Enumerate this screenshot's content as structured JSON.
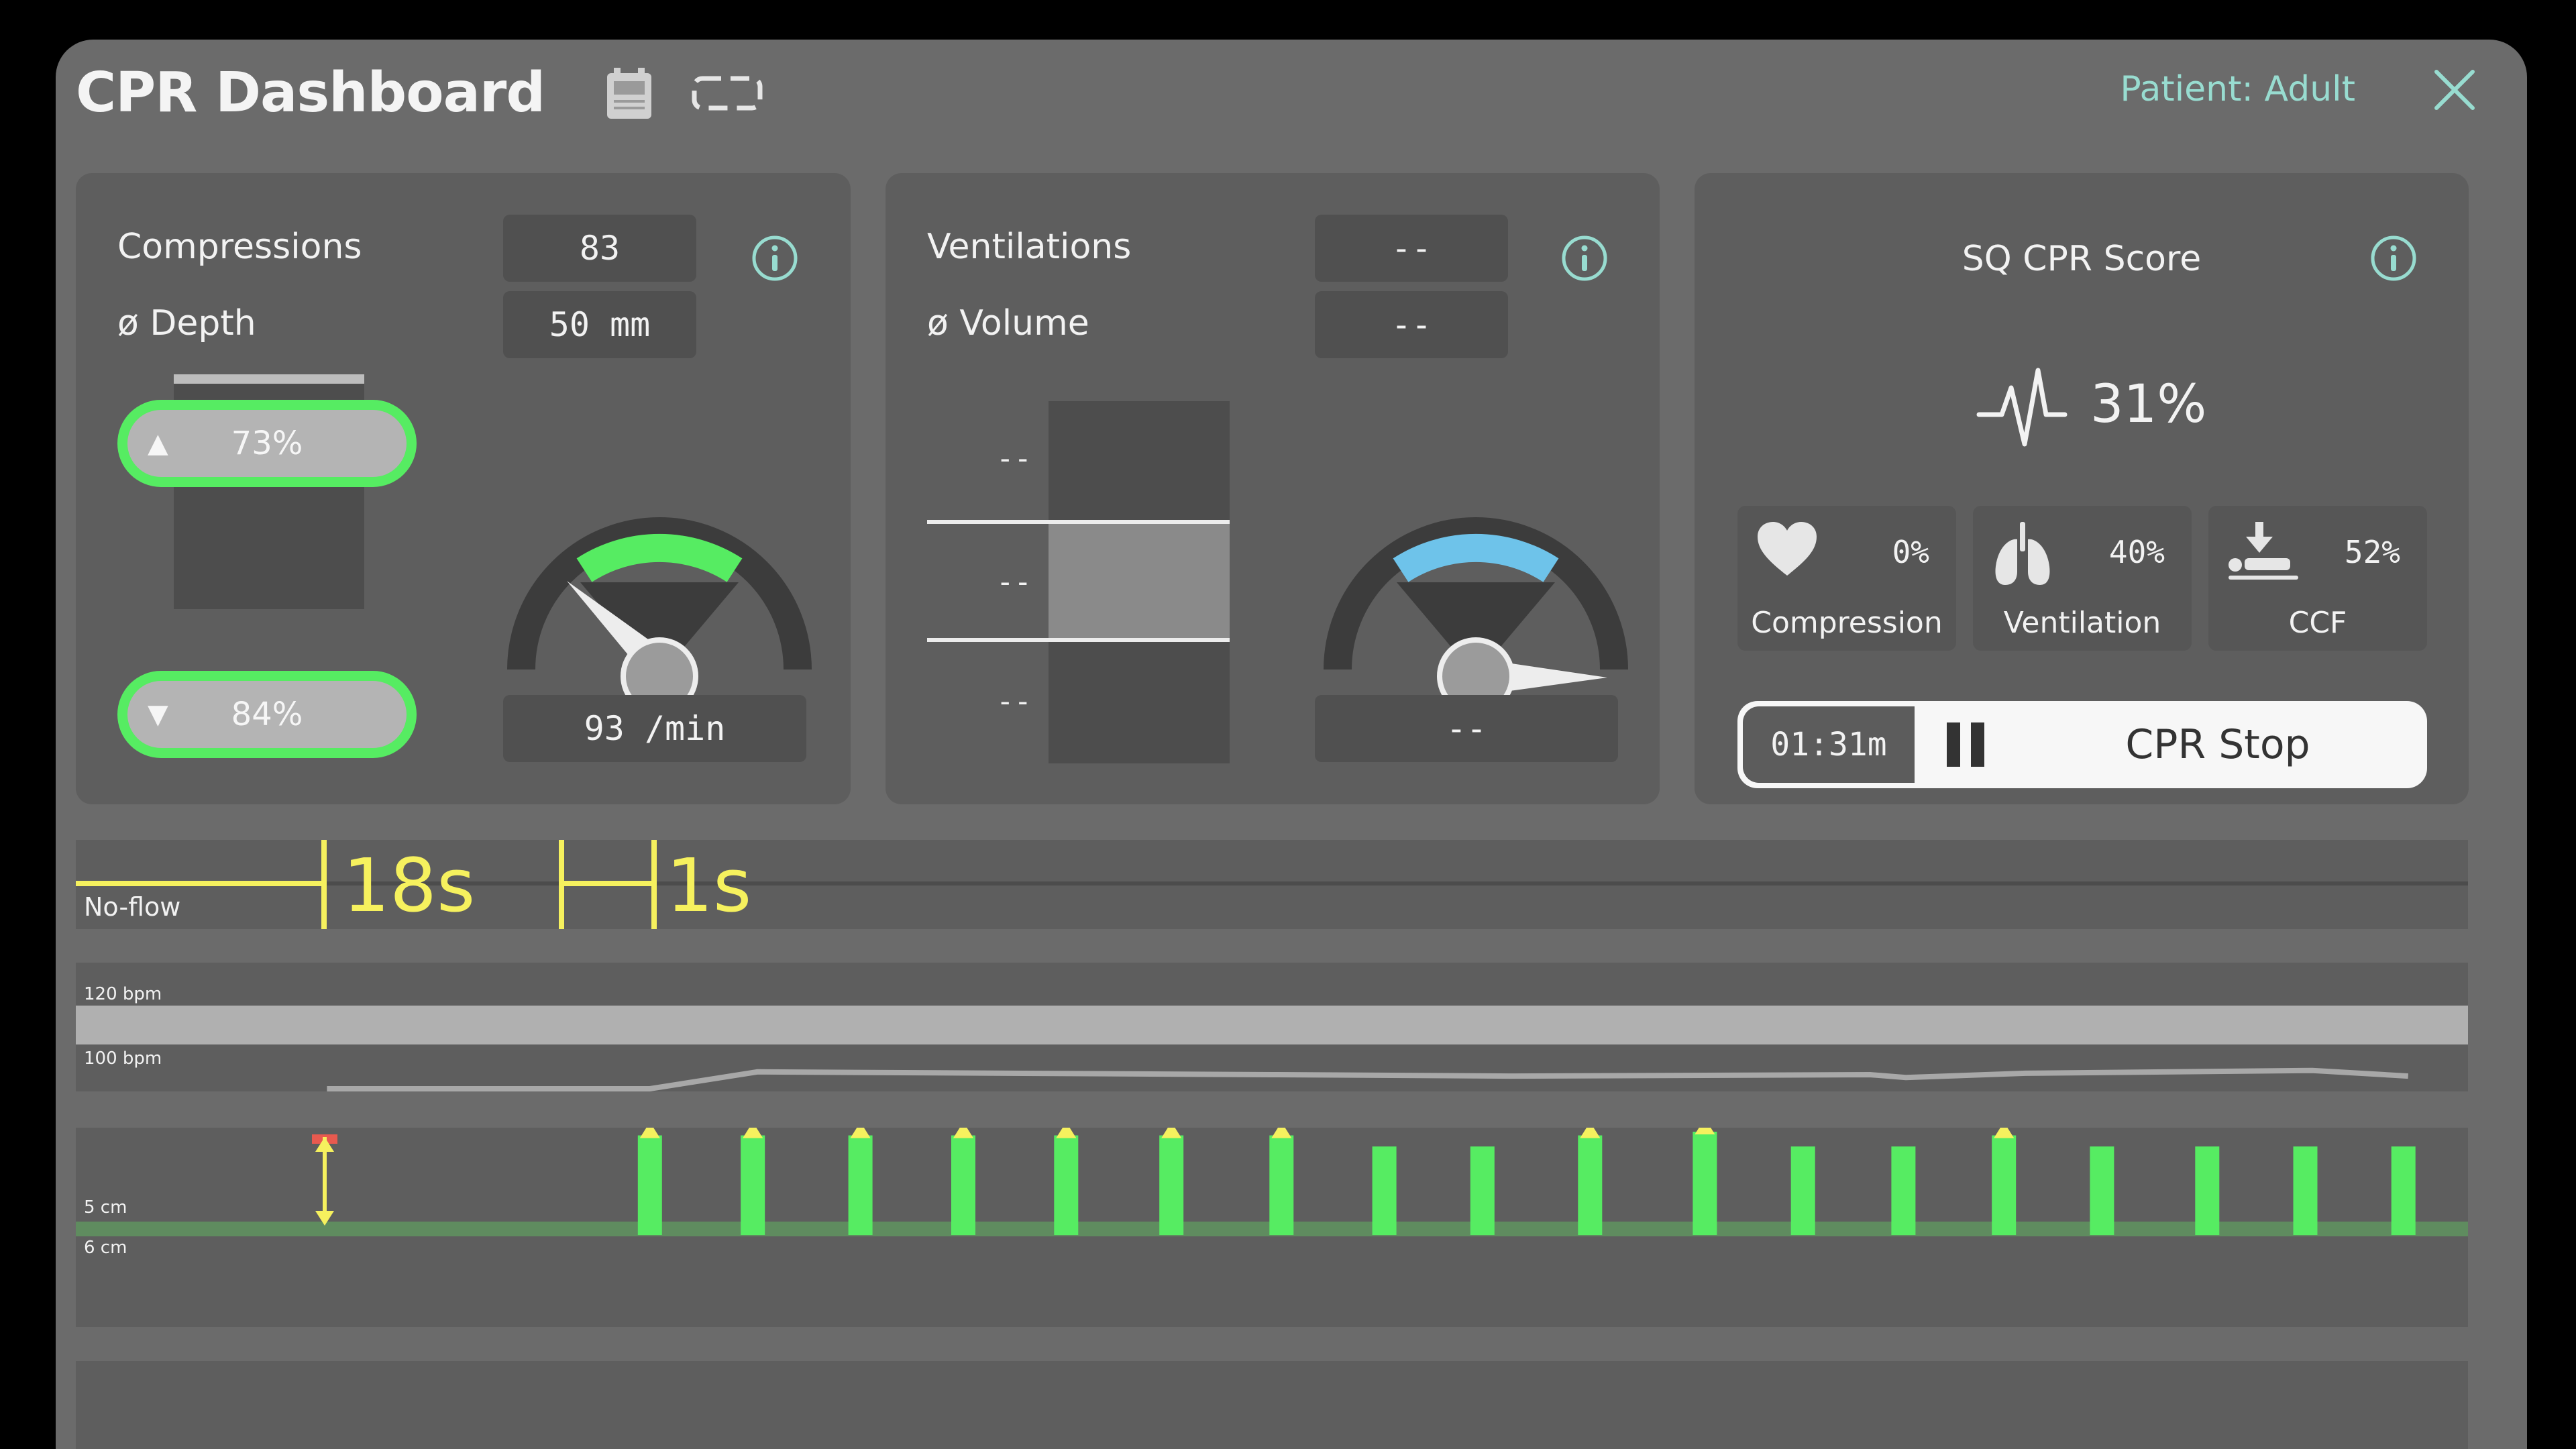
{
  "header": {
    "title": "CPR Dashboard",
    "patient": "Patient: Adult"
  },
  "compressions": {
    "label": "Compressions",
    "value": "83",
    "depth_label": "ø Depth",
    "depth_value": "50 mm",
    "upper_pct": "73%",
    "lower_pct": "84%",
    "rate": "93 /min"
  },
  "ventilations": {
    "label": "Ventilations",
    "value": "--",
    "volume_label": "ø Volume",
    "volume_value": "--",
    "bar_top": "--",
    "bar_mid": "--",
    "bar_bottom": "--",
    "rate": "--"
  },
  "score": {
    "title": "SQ CPR Score",
    "value": "31%",
    "tiles": [
      {
        "name": "Compression",
        "value": "0%"
      },
      {
        "name": "Ventilation",
        "value": "40%"
      },
      {
        "name": "CCF",
        "value": "52%"
      }
    ]
  },
  "timer": {
    "elapsed": "01:31m",
    "stop_label": "CPR Stop"
  },
  "noflow": {
    "label": "No-flow",
    "first": "18s",
    "second": "1s"
  },
  "rate_chart": {
    "upper_label": "120 bpm",
    "lower_label": "100 bpm",
    "values": [
      {
        "x": 0.105,
        "bpm": 100
      },
      {
        "x": 0.24,
        "bpm": 100
      },
      {
        "x": 0.285,
        "bpm": 112
      },
      {
        "x": 0.5,
        "bpm": 110
      },
      {
        "x": 0.6,
        "bpm": 109
      },
      {
        "x": 0.75,
        "bpm": 110
      },
      {
        "x": 0.765,
        "bpm": 108
      },
      {
        "x": 0.815,
        "bpm": 111
      },
      {
        "x": 0.935,
        "bpm": 113
      },
      {
        "x": 0.975,
        "bpm": 109
      }
    ]
  },
  "depth_chart": {
    "label_5cm": "5 cm",
    "label_6cm": "6 cm",
    "bars": [
      {
        "x": 0.24,
        "cm": 5.35,
        "too_shallow": true
      },
      {
        "x": 0.283,
        "cm": 5.35,
        "too_shallow": true
      },
      {
        "x": 0.328,
        "cm": 5.35,
        "too_shallow": true
      },
      {
        "x": 0.371,
        "cm": 5.35,
        "too_shallow": true
      },
      {
        "x": 0.414,
        "cm": 5.35,
        "too_shallow": true
      },
      {
        "x": 0.458,
        "cm": 5.35,
        "too_shallow": true
      },
      {
        "x": 0.504,
        "cm": 5.35,
        "too_shallow": true
      },
      {
        "x": 0.547,
        "cm": 5.2,
        "too_shallow": false
      },
      {
        "x": 0.588,
        "cm": 5.2,
        "too_shallow": false
      },
      {
        "x": 0.633,
        "cm": 5.35,
        "too_shallow": true
      },
      {
        "x": 0.681,
        "cm": 5.4,
        "too_shallow": true
      },
      {
        "x": 0.722,
        "cm": 5.2,
        "too_shallow": false
      },
      {
        "x": 0.764,
        "cm": 5.2,
        "too_shallow": false
      },
      {
        "x": 0.806,
        "cm": 5.35,
        "too_shallow": true
      },
      {
        "x": 0.847,
        "cm": 5.2,
        "too_shallow": false
      },
      {
        "x": 0.891,
        "cm": 5.2,
        "too_shallow": false
      },
      {
        "x": 0.932,
        "cm": 5.2,
        "too_shallow": false
      },
      {
        "x": 0.973,
        "cm": 5.2,
        "too_shallow": false
      }
    ]
  },
  "colors": {
    "green": "#56ec62",
    "yellow": "#f6f15e",
    "blue": "#6ec3ea",
    "red": "#e85a4f"
  },
  "icons": {
    "pump": "infusion-pump-icon",
    "monitor": "monitor-frame-icon",
    "info": "info-circle-icon",
    "close": "close-icon",
    "heart": "heart-icon",
    "lungs": "lungs-icon",
    "ccf": "patient-compression-icon",
    "pulse": "pulse-wave-icon",
    "pause": "pause-icon"
  }
}
